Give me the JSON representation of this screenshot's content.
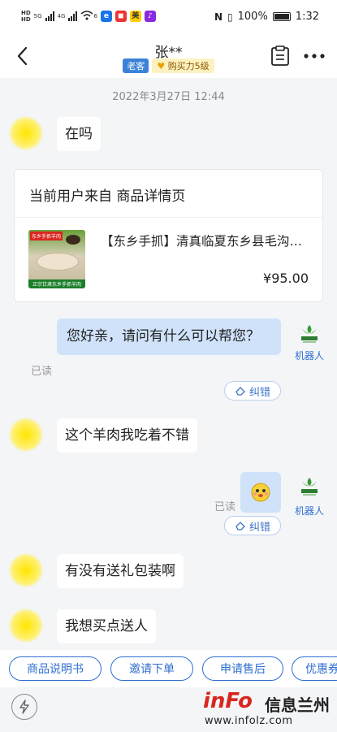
{
  "status_bar": {
    "network_left": "HD",
    "network_top": "5G",
    "network_second": "4G",
    "wifi_badge": "6",
    "app_icon_2": "美",
    "battery_pct": "100%",
    "time": "1:32"
  },
  "header": {
    "title": "张**",
    "badge_old_customer": "老客",
    "badge_buying_power": "购买力5级"
  },
  "timestamp": "2022年3月27日 12:44",
  "messages": {
    "m1": "在吗",
    "card": {
      "source_label": "当前用户来自 商品详情页",
      "product_title": "【东乡手抓】清真临夏东乡县毛沟滩羊",
      "price": "¥95.00",
      "image_tag": "东乡手抓羊肉",
      "image_footer": "正宗甘肃东乡手抓羊肉"
    },
    "bot_reply": "您好亲，请问有什么可以帮您？",
    "read_1": "已读",
    "bot_label_1": "机器人",
    "correct_1": "纠错",
    "m2": "这个羊肉我吃着不错",
    "read_2": "已读",
    "bot_label_2": "机器人",
    "correct_2": "纠错",
    "m3": "有没有送礼包装啊",
    "m4": "我想买点送人"
  },
  "quick_actions": [
    "商品说明书",
    "邀请下单",
    "申请售后",
    "优惠券"
  ],
  "watermark": {
    "logo": "inFo",
    "cn": "信息兰州",
    "url": "www.infolz.com"
  },
  "colors": {
    "accent": "#2f6fd0",
    "bubble_right": "#cfe2fa",
    "avatar_yellow": "#ffe600"
  }
}
